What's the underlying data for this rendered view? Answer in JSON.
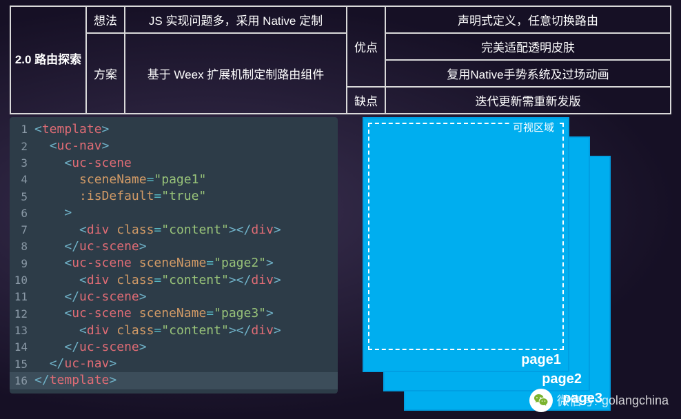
{
  "table": {
    "header": "2.0 路由探索",
    "rows": [
      {
        "label": "想法",
        "text": "JS 实现问题多，采用 Native 定制"
      },
      {
        "label": "方案",
        "text": "基于 Weex 扩展机制定制路由组件"
      }
    ],
    "pros_label": "优点",
    "cons_label": "缺点",
    "pros": [
      "声明式定义，任意切换路由",
      "完美适配透明皮肤",
      "复用Native手势系统及过场动画"
    ],
    "cons": [
      "迭代更新需重新发版"
    ]
  },
  "code": [
    [
      {
        "c": "t-ang",
        "t": "<"
      },
      {
        "c": "t-tag",
        "t": "template"
      },
      {
        "c": "t-ang",
        "t": ">"
      }
    ],
    [
      {
        "c": "t-txt",
        "t": "  "
      },
      {
        "c": "t-ang",
        "t": "<"
      },
      {
        "c": "t-tag",
        "t": "uc-nav"
      },
      {
        "c": "t-ang",
        "t": ">"
      }
    ],
    [
      {
        "c": "t-txt",
        "t": "    "
      },
      {
        "c": "t-ang",
        "t": "<"
      },
      {
        "c": "t-tag",
        "t": "uc-scene"
      }
    ],
    [
      {
        "c": "t-txt",
        "t": "      "
      },
      {
        "c": "t-attr",
        "t": "sceneName"
      },
      {
        "c": "t-eq",
        "t": "="
      },
      {
        "c": "t-str",
        "t": "\"page1\""
      }
    ],
    [
      {
        "c": "t-txt",
        "t": "      "
      },
      {
        "c": "t-attr",
        "t": ":isDefault"
      },
      {
        "c": "t-eq",
        "t": "="
      },
      {
        "c": "t-str",
        "t": "\"true\""
      }
    ],
    [
      {
        "c": "t-txt",
        "t": "    "
      },
      {
        "c": "t-ang",
        "t": ">"
      }
    ],
    [
      {
        "c": "t-txt",
        "t": "      "
      },
      {
        "c": "t-ang",
        "t": "<"
      },
      {
        "c": "t-tag",
        "t": "div"
      },
      {
        "c": "t-txt",
        "t": " "
      },
      {
        "c": "t-attr",
        "t": "class"
      },
      {
        "c": "t-eq",
        "t": "="
      },
      {
        "c": "t-str",
        "t": "\"content\""
      },
      {
        "c": "t-ang",
        "t": "></"
      },
      {
        "c": "t-tag",
        "t": "div"
      },
      {
        "c": "t-ang",
        "t": ">"
      }
    ],
    [
      {
        "c": "t-txt",
        "t": "    "
      },
      {
        "c": "t-ang",
        "t": "</"
      },
      {
        "c": "t-tag",
        "t": "uc-scene"
      },
      {
        "c": "t-ang",
        "t": ">"
      }
    ],
    [
      {
        "c": "t-txt",
        "t": "    "
      },
      {
        "c": "t-ang",
        "t": "<"
      },
      {
        "c": "t-tag",
        "t": "uc-scene"
      },
      {
        "c": "t-txt",
        "t": " "
      },
      {
        "c": "t-attr",
        "t": "sceneName"
      },
      {
        "c": "t-eq",
        "t": "="
      },
      {
        "c": "t-str",
        "t": "\"page2\""
      },
      {
        "c": "t-ang",
        "t": ">"
      }
    ],
    [
      {
        "c": "t-txt",
        "t": "      "
      },
      {
        "c": "t-ang",
        "t": "<"
      },
      {
        "c": "t-tag",
        "t": "div"
      },
      {
        "c": "t-txt",
        "t": " "
      },
      {
        "c": "t-attr",
        "t": "class"
      },
      {
        "c": "t-eq",
        "t": "="
      },
      {
        "c": "t-str",
        "t": "\"content\""
      },
      {
        "c": "t-ang",
        "t": "></"
      },
      {
        "c": "t-tag",
        "t": "div"
      },
      {
        "c": "t-ang",
        "t": ">"
      }
    ],
    [
      {
        "c": "t-txt",
        "t": "    "
      },
      {
        "c": "t-ang",
        "t": "</"
      },
      {
        "c": "t-tag",
        "t": "uc-scene"
      },
      {
        "c": "t-ang",
        "t": ">"
      }
    ],
    [
      {
        "c": "t-txt",
        "t": "    "
      },
      {
        "c": "t-ang",
        "t": "<"
      },
      {
        "c": "t-tag",
        "t": "uc-scene"
      },
      {
        "c": "t-txt",
        "t": " "
      },
      {
        "c": "t-attr",
        "t": "sceneName"
      },
      {
        "c": "t-eq",
        "t": "="
      },
      {
        "c": "t-str",
        "t": "\"page3\""
      },
      {
        "c": "t-ang",
        "t": ">"
      }
    ],
    [
      {
        "c": "t-txt",
        "t": "      "
      },
      {
        "c": "t-ang",
        "t": "<"
      },
      {
        "c": "t-tag",
        "t": "div"
      },
      {
        "c": "t-txt",
        "t": " "
      },
      {
        "c": "t-attr",
        "t": "class"
      },
      {
        "c": "t-eq",
        "t": "="
      },
      {
        "c": "t-str",
        "t": "\"content\""
      },
      {
        "c": "t-ang",
        "t": "></"
      },
      {
        "c": "t-tag",
        "t": "div"
      },
      {
        "c": "t-ang",
        "t": ">"
      }
    ],
    [
      {
        "c": "t-txt",
        "t": "    "
      },
      {
        "c": "t-ang",
        "t": "</"
      },
      {
        "c": "t-tag",
        "t": "uc-scene"
      },
      {
        "c": "t-ang",
        "t": ">"
      }
    ],
    [
      {
        "c": "t-txt",
        "t": "  "
      },
      {
        "c": "t-ang",
        "t": "</"
      },
      {
        "c": "t-tag",
        "t": "uc-nav"
      },
      {
        "c": "t-ang",
        "t": ">"
      }
    ],
    [
      {
        "c": "t-ang",
        "t": "</"
      },
      {
        "c": "t-tag",
        "t": "template"
      },
      {
        "c": "t-ang",
        "t": ">"
      }
    ]
  ],
  "diagram": {
    "viewport_label": "可视区域",
    "pages": [
      "page1",
      "page2",
      "page3"
    ]
  },
  "watermark": {
    "prefix": "微信号:",
    "id": "golangchina"
  }
}
